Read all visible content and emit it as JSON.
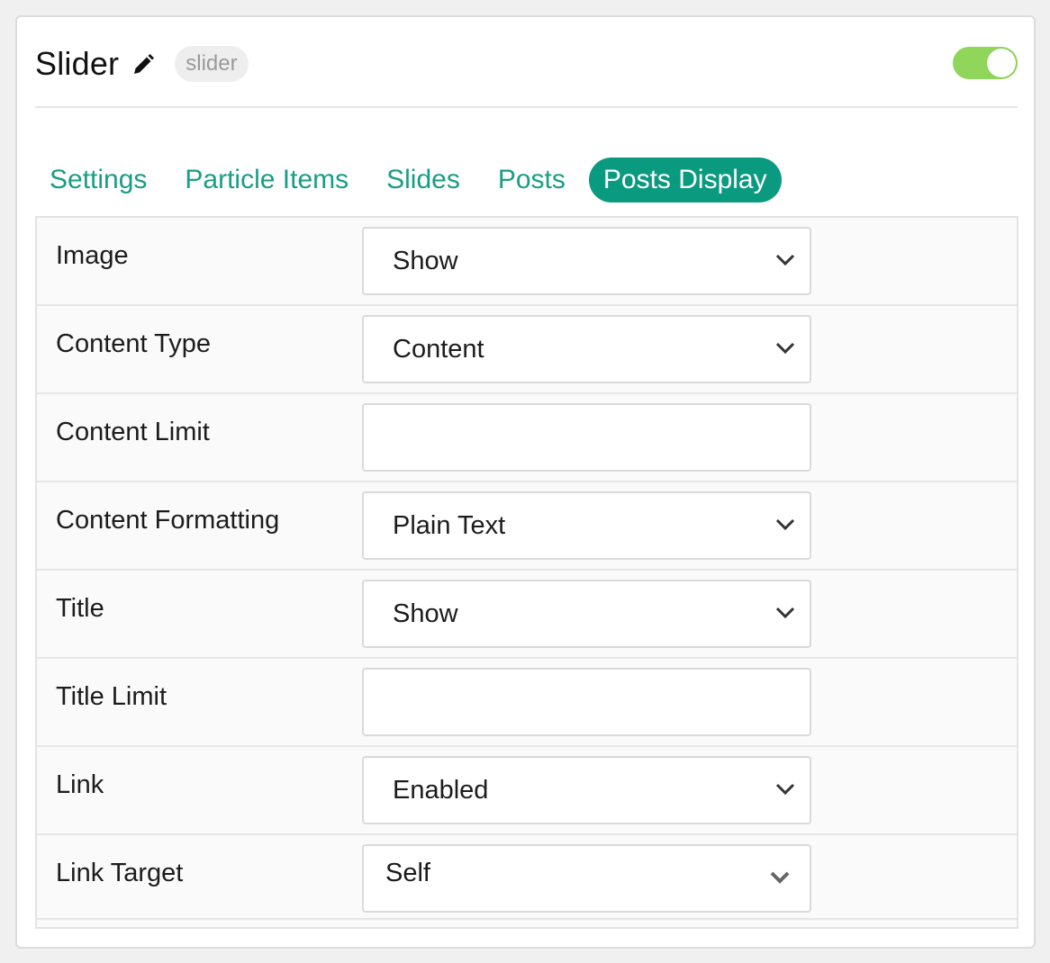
{
  "header": {
    "title": "Slider",
    "badge": "slider",
    "enabled": true,
    "toggle_color": "#8fd65a"
  },
  "tabs": [
    {
      "label": "Settings",
      "active": false
    },
    {
      "label": "Particle Items",
      "active": false
    },
    {
      "label": "Slides",
      "active": false
    },
    {
      "label": "Posts",
      "active": false
    },
    {
      "label": "Posts Display",
      "active": true
    }
  ],
  "accent_color": "#0a9a7f",
  "fields": [
    {
      "label": "Image",
      "type": "select",
      "value": "Show"
    },
    {
      "label": "Content Type",
      "type": "select",
      "value": "Content"
    },
    {
      "label": "Content Limit",
      "type": "text",
      "value": ""
    },
    {
      "label": "Content Formatting",
      "type": "select",
      "value": "Plain Text"
    },
    {
      "label": "Title",
      "type": "select",
      "value": "Show"
    },
    {
      "label": "Title Limit",
      "type": "text",
      "value": ""
    },
    {
      "label": "Link",
      "type": "select",
      "value": "Enabled"
    },
    {
      "label": "Link Target",
      "type": "select",
      "value": "Self"
    }
  ],
  "icons": {
    "edit": "pencil-icon",
    "dropdown": "chevron-down-icon"
  }
}
